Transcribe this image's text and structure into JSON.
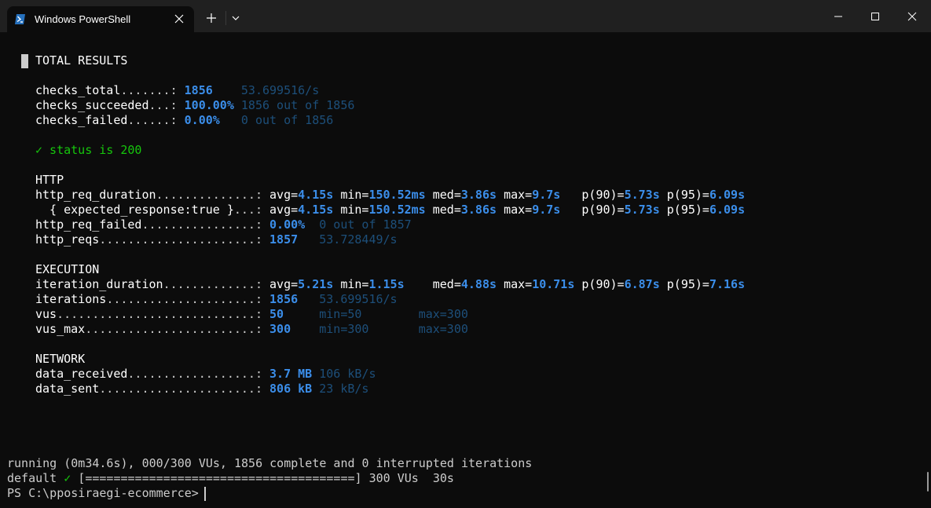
{
  "window": {
    "tab_title": "Windows PowerShell",
    "icons": {
      "tab": "powershell-icon",
      "close_tab": "close-icon",
      "new_tab": "plus-icon",
      "dropdown": "chevron-down-icon",
      "minimize": "minimize-icon",
      "maximize": "maximize-icon",
      "close_window": "close-icon"
    }
  },
  "colors": {
    "background": "#0c0c0c",
    "titlebar": "#202020",
    "value": "#3b8eea",
    "dim": "#1d4f7a",
    "success": "#16c60c",
    "text": "#cccccc"
  },
  "summary": {
    "header": "TOTAL RESULTS",
    "checks": [
      {
        "name": "checks_total",
        "dots": ".......:",
        "value": "1856",
        "rate": "53.699516/s"
      },
      {
        "name": "checks_succeeded",
        "dots": "...:",
        "value": "100.00%",
        "rate": "1856 out of 1856"
      },
      {
        "name": "checks_failed",
        "dots": "......:",
        "value": "0.00%",
        "rate": "0 out of 1856"
      }
    ],
    "status_check": "✓ status is 200",
    "http": {
      "header": "HTTP",
      "req_duration": {
        "name": "http_req_duration",
        "dots": "..............:"
      },
      "expected": {
        "name": "  { expected_response:true }",
        "dots": "...:"
      },
      "stats": {
        "avg_label": "avg=",
        "avg": "4.15s",
        "min_label": "min=",
        "min": "150.52ms",
        "med_label": "med=",
        "med": "3.86s",
        "max_label": "max=",
        "max": "9.7s",
        "p90_label": "p(90)=",
        "p90": "5.73s",
        "p95_label": "p(95)=",
        "p95": "6.09s"
      },
      "req_failed": {
        "name": "http_req_failed",
        "dots": "................:",
        "value": "0.00%",
        "rate": "0 out of 1857"
      },
      "reqs": {
        "name": "http_reqs",
        "dots": "......................:",
        "value": "1857",
        "rate": "53.728449/s"
      }
    },
    "execution": {
      "header": "EXECUTION",
      "iteration_duration": {
        "name": "iteration_duration",
        "dots": ".............:",
        "avg_label": "avg=",
        "avg": "5.21s",
        "min_label": "min=",
        "min": "1.15s",
        "med_label": "med=",
        "med": "4.88s",
        "max_label": "max=",
        "max": "10.71s",
        "p90_label": "p(90)=",
        "p90": "6.87s",
        "p95_label": "p(95)=",
        "p95": "7.16s"
      },
      "iterations": {
        "name": "iterations",
        "dots": ".....................:",
        "value": "1856",
        "rate": "53.699516/s"
      },
      "vus": {
        "name": "vus",
        "dots": "............................:",
        "value": "50",
        "min": "min=50",
        "max": "max=300"
      },
      "vus_max": {
        "name": "vus_max",
        "dots": "........................:",
        "value": "300",
        "min": "min=300",
        "max": "max=300"
      }
    },
    "network": {
      "header": "NETWORK",
      "data_received": {
        "name": "data_received",
        "dots": "..................:",
        "value": "3.7 MB",
        "rate": "106 kB/s"
      },
      "data_sent": {
        "name": "data_sent",
        "dots": "......................:",
        "value": "806 kB",
        "rate": "23 kB/s"
      }
    }
  },
  "footer": {
    "running": "running (0m34.6s), 000/300 VUs, 1856 complete and 0 interrupted iterations",
    "default_label": "default",
    "check": "✓",
    "progress": "[======================================]",
    "progress_fraction": 1.0,
    "vus": "300 VUs",
    "duration": "30s",
    "prompt": "PS C:\\pposiraegi-ecommerce>"
  }
}
